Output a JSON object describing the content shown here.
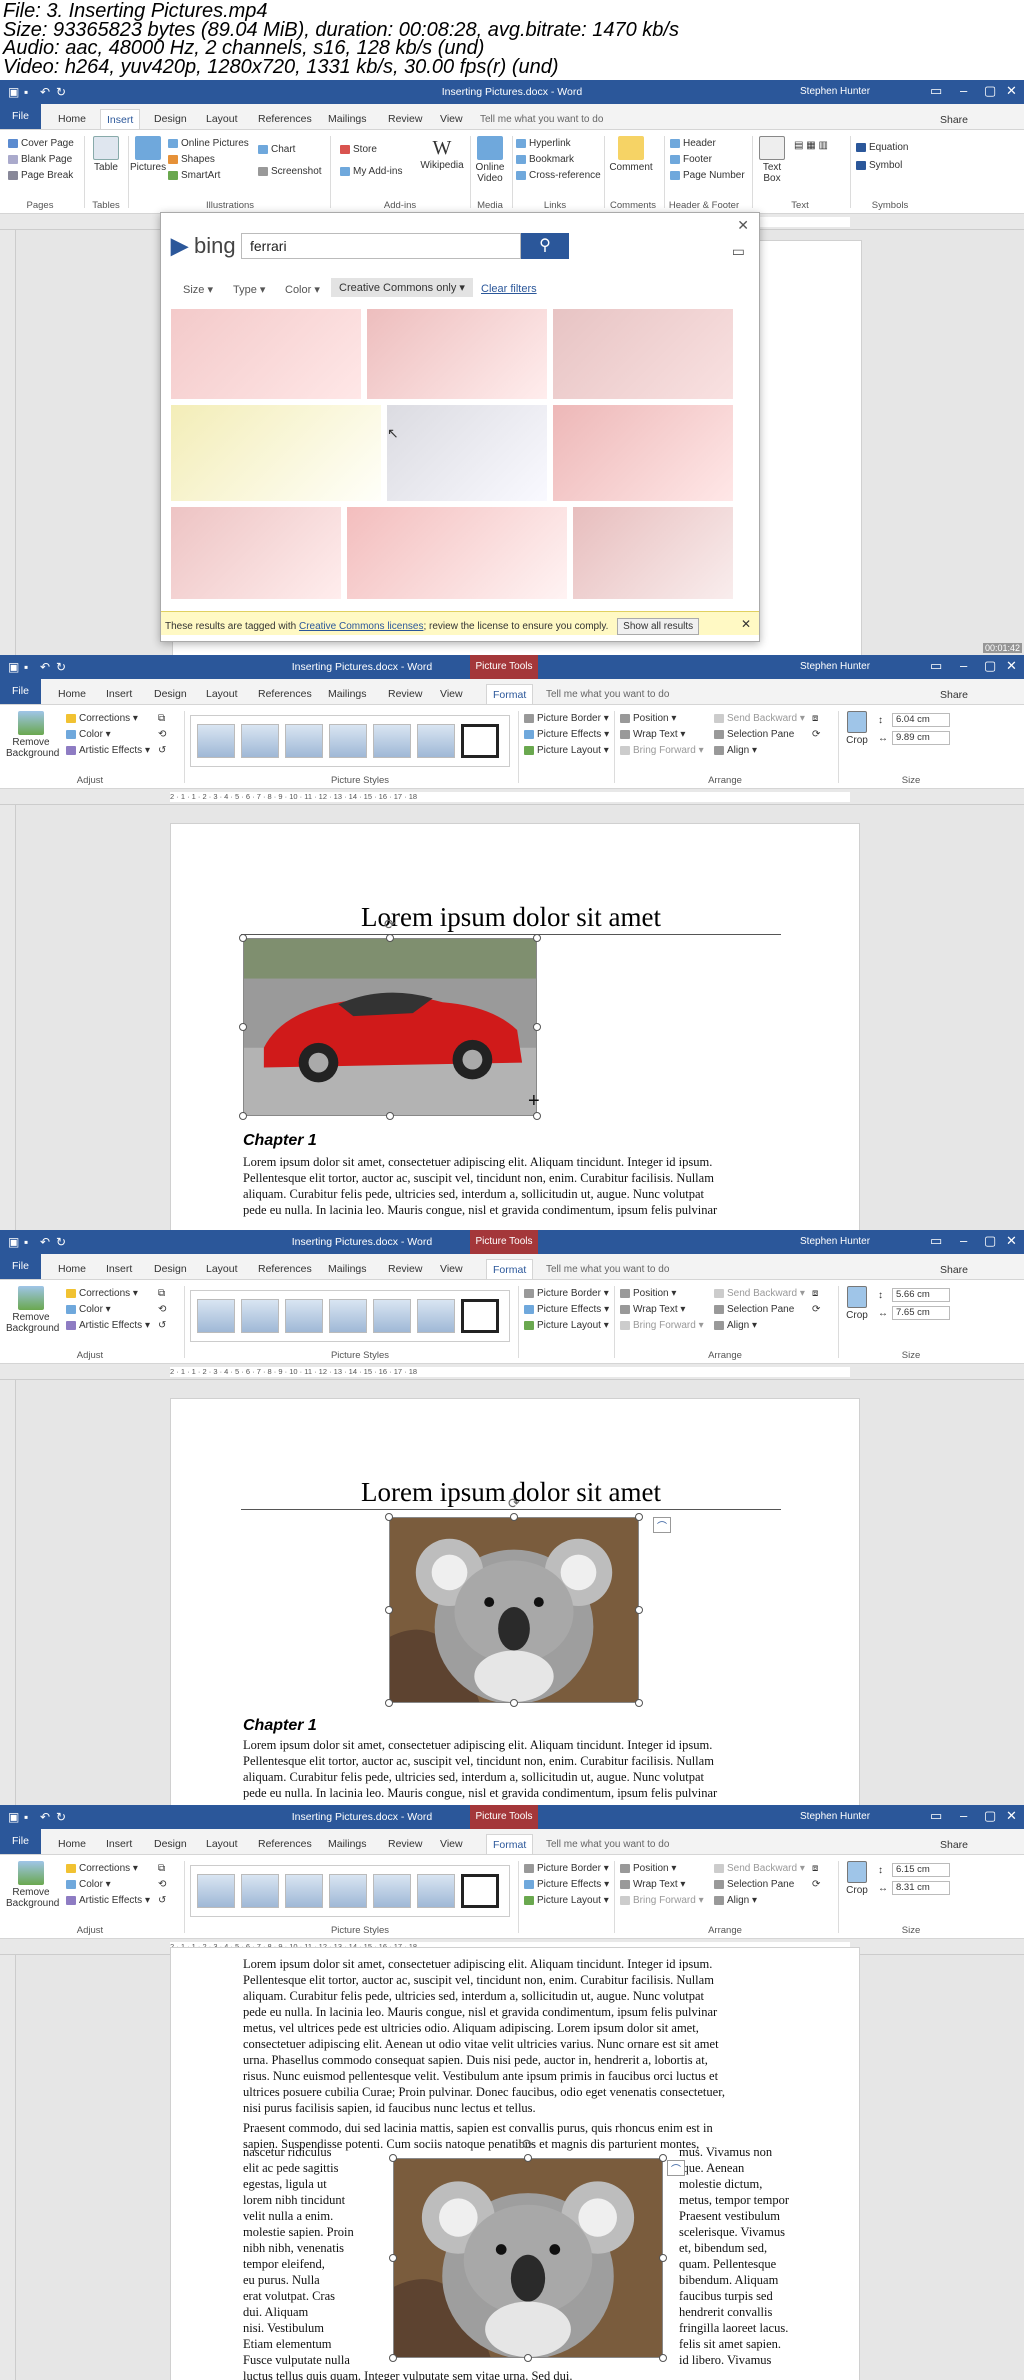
{
  "header": {
    "file": "File: 3. Inserting Pictures.mp4",
    "size": "Size: 93365823 bytes (89.04 MiB), duration: 00:08:28, avg.bitrate: 1470 kb/s",
    "audio": "Audio: aac, 48000 Hz, 2 channels, s16, 128 kb/s (und)",
    "video": "Video: h264, yuv420p, 1280x720, 1331 kb/s, 30.00 fps(r) (und)"
  },
  "app": {
    "title_normal": "Inserting Pictures.docx - Word",
    "picture_tools": "Picture Tools",
    "user": "Stephen Hunter",
    "tell_me": "Tell me what you want to do",
    "share": "Share"
  },
  "tabs_insert": [
    "Home",
    "Insert",
    "Design",
    "Layout",
    "References",
    "Mailings",
    "Review",
    "View"
  ],
  "tabs_format": [
    "Home",
    "Insert",
    "Design",
    "Layout",
    "References",
    "Mailings",
    "Review",
    "View",
    "Format"
  ],
  "file_tab": "File",
  "insert_ribbon": {
    "pages": [
      "Cover Page",
      "Blank Page",
      "Page Break"
    ],
    "pages_label": "Pages",
    "table": "Table",
    "tables_label": "Tables",
    "pictures": "Pictures",
    "illus_small": [
      "Online Pictures",
      "Shapes",
      "SmartArt"
    ],
    "chart": "Chart",
    "screenshot": "Screenshot",
    "illus_label": "Illustrations",
    "store": "Store",
    "myaddins": "My Add-ins",
    "wikipedia": "Wikipedia",
    "addins_label": "Add-ins",
    "online_video": "Online Video",
    "media_label": "Media",
    "links": [
      "Hyperlink",
      "Bookmark",
      "Cross-reference"
    ],
    "links_label": "Links",
    "comment": "Comment",
    "comments_label": "Comments",
    "hf": [
      "Header",
      "Footer",
      "Page Number"
    ],
    "hf_label": "Header & Footer",
    "textbox": "Text Box",
    "text_label": "Text",
    "symbols": [
      "Equation",
      "Symbol"
    ],
    "symbols_label": "Symbols"
  },
  "format_ribbon": {
    "remove_bg": "Remove Background",
    "adjust": [
      "Corrections",
      "Color",
      "Artistic Effects"
    ],
    "adjust_label": "Adjust",
    "styles_label": "Picture Styles",
    "pic": [
      "Picture Border",
      "Picture Effects",
      "Picture Layout"
    ],
    "arrange_col1": [
      "Position",
      "Wrap Text",
      "Bring Forward"
    ],
    "arrange_col2": [
      "Send Backward",
      "Selection Pane",
      "Align"
    ],
    "arrange_label": "Arrange",
    "crop": "Crop",
    "size_label": "Size"
  },
  "sizes": [
    {
      "h": "6.04 cm",
      "w": "9.89 cm"
    },
    {
      "h": "5.66 cm",
      "w": "7.65 cm"
    },
    {
      "h": "6.15 cm",
      "w": "8.31 cm"
    }
  ],
  "bing": {
    "logo": "bing",
    "query": "ferrari",
    "filters": [
      "Size",
      "Type",
      "Color"
    ],
    "cc": "Creative Commons only",
    "clear": "Clear filters",
    "notice_a": "These results are tagged with",
    "notice_link": "Creative Commons licenses",
    "notice_b": "; review the license to ensure you comply.",
    "show_all": "Show all results"
  },
  "doc": {
    "title": "Lorem ipsum dolor sit amet",
    "chapter": "Chapter 1",
    "body_lines": [
      "Lorem ipsum dolor sit amet, consectetuer adipiscing elit. Aliquam tincidunt. Integer id ipsum.",
      "Pellentesque elit tortor, auctor ac, suscipit vel, tincidunt non, enim. Curabitur facilisis. Nullam",
      "aliquam. Curabitur felis pede, ultricies sed, interdum a, sollicitudin ut, augue. Nunc volutpat",
      "pede eu nulla. In lacinia leo. Mauris congue, nisl et gravida condimentum, ipsum felis pulvinar"
    ],
    "body4_lines": [
      "Lorem ipsum dolor sit amet, consectetuer adipiscing elit. Aliquam tincidunt. Integer id ipsum.",
      "Pellentesque elit tortor, auctor ac, suscipit vel, tincidunt non, enim. Curabitur facilisis. Nullam",
      "aliquam. Curabitur felis pede, ultricies sed, interdum a, sollicitudin ut, augue. Nunc volutpat",
      "pede eu nulla. In lacinia leo. Mauris congue, nisl et gravida condimentum, ipsum felis pulvinar",
      "metus, vel ultrices pede est ultricies odio. Aliquam adipiscing. Lorem ipsum dolor sit amet,",
      "consectetuer adipiscing elit. Aenean ut odio vitae velit ultricies varius. Nunc ornare est sit amet",
      "urna. Phasellus commodo consequat sapien. Duis nisi pede, auctor in, hendrerit a, lobortis at,",
      "risus. Nunc euismod pellentesque velit. Vestibulum ante ipsum primis in faucibus orci luctus et",
      "ultrices posuere cubilia Curae; Proin pulvinar. Donec faucibus, odio eget venenatis consectetuer,",
      "nisi purus facilisis sapien, id faucibus nunc lectus et tellus."
    ],
    "para2_lines": [
      "Praesent commodo, dui sed lacinia mattis, sapien est convallis purus, quis rhoncus enim est in",
      "sapien. Suspendisse potenti. Cum sociis natoque penatibus et magnis dis parturient montes,"
    ],
    "wrap_left": [
      "nascetur ridiculus",
      "elit ac pede sagittis",
      "egestas, ligula ut",
      "lorem nibh tincidunt",
      "velit nulla a enim.",
      "molestie sapien. Proin",
      "nibh nibh, venenatis",
      "tempor eleifend,",
      "eu purus. Nulla",
      "erat volutpat. Cras",
      "dui. Aliquam",
      "nisi. Vestibulum",
      "Etiam elementum",
      "Fusce vulputate nulla"
    ],
    "wrap_right": [
      "mus. Vivamus non",
      "ique. Aenean",
      "molestie dictum,",
      "metus, tempor tempor",
      "Praesent vestibulum",
      "scelerisque. Vivamus",
      "et, bibendum sed,",
      "quam. Pellentesque",
      "bibendum. Aliquam",
      "faucibus turpis sed",
      "hendrerit convallis",
      "fringilla laoreet lacus.",
      "felis sit amet sapien.",
      "id libero. Vivamus"
    ],
    "last_line": "luctus tellus quis quam. Integer vulputate sem vitae urna. Sed dui."
  },
  "ruler_text": "2 · 1 · 1 · 2 · 3 · 4 · 5 · 6 · 7 · 8 · 9 · 10 · 11 · 12 · 13 · 14 · 15 · 16 · 17 · 18"
}
